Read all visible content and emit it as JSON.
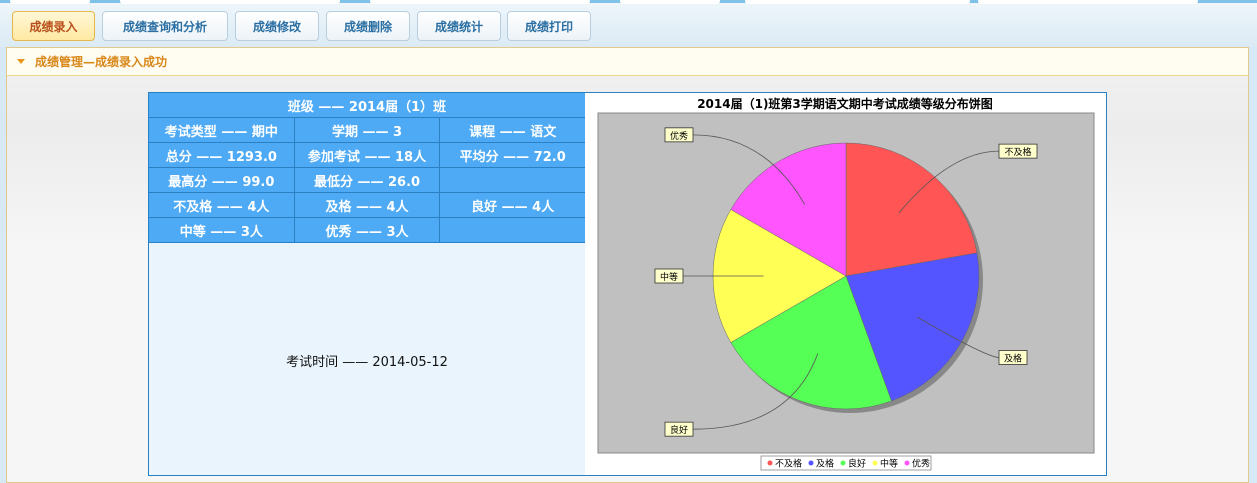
{
  "tabs": [
    {
      "label": "成绩录入",
      "active": true
    },
    {
      "label": "成绩查询和分析",
      "active": false
    },
    {
      "label": "成绩修改",
      "active": false
    },
    {
      "label": "成绩删除",
      "active": false
    },
    {
      "label": "成绩统计",
      "active": false
    },
    {
      "label": "成绩打印",
      "active": false
    }
  ],
  "panel": {
    "title": "成绩管理—成绩录入成功"
  },
  "info": {
    "class_title": "班级 —— 2014届（1）班",
    "rows": [
      [
        "考试类型 —— 期中",
        "学期 —— 3",
        "课程 —— 语文"
      ],
      [
        "总分 —— 1293.0",
        "参加考试 —— 18人",
        "平均分 —— 72.0"
      ],
      [
        "最高分 —— 99.0",
        "最低分 —— 26.0",
        ""
      ],
      [
        "不及格 —— 4人",
        "及格 —— 4人",
        "良好 —— 4人"
      ],
      [
        "中等 —— 3人",
        "优秀 —— 3人",
        ""
      ]
    ],
    "exam_time": "考试时间 —— 2014-05-12"
  },
  "chart_data": {
    "type": "pie",
    "title": "2014届（1)班第3学期语文期中考试成绩等级分布饼图",
    "categories": [
      "不及格",
      "及格",
      "良好",
      "中等",
      "优秀"
    ],
    "values": [
      4,
      4,
      4,
      3,
      3
    ],
    "colors": [
      "#ff5555",
      "#5555ff",
      "#55ff55",
      "#ffff55",
      "#ff55ff"
    ],
    "legend_position": "bottom",
    "plot_background": "#c0c0c0"
  }
}
